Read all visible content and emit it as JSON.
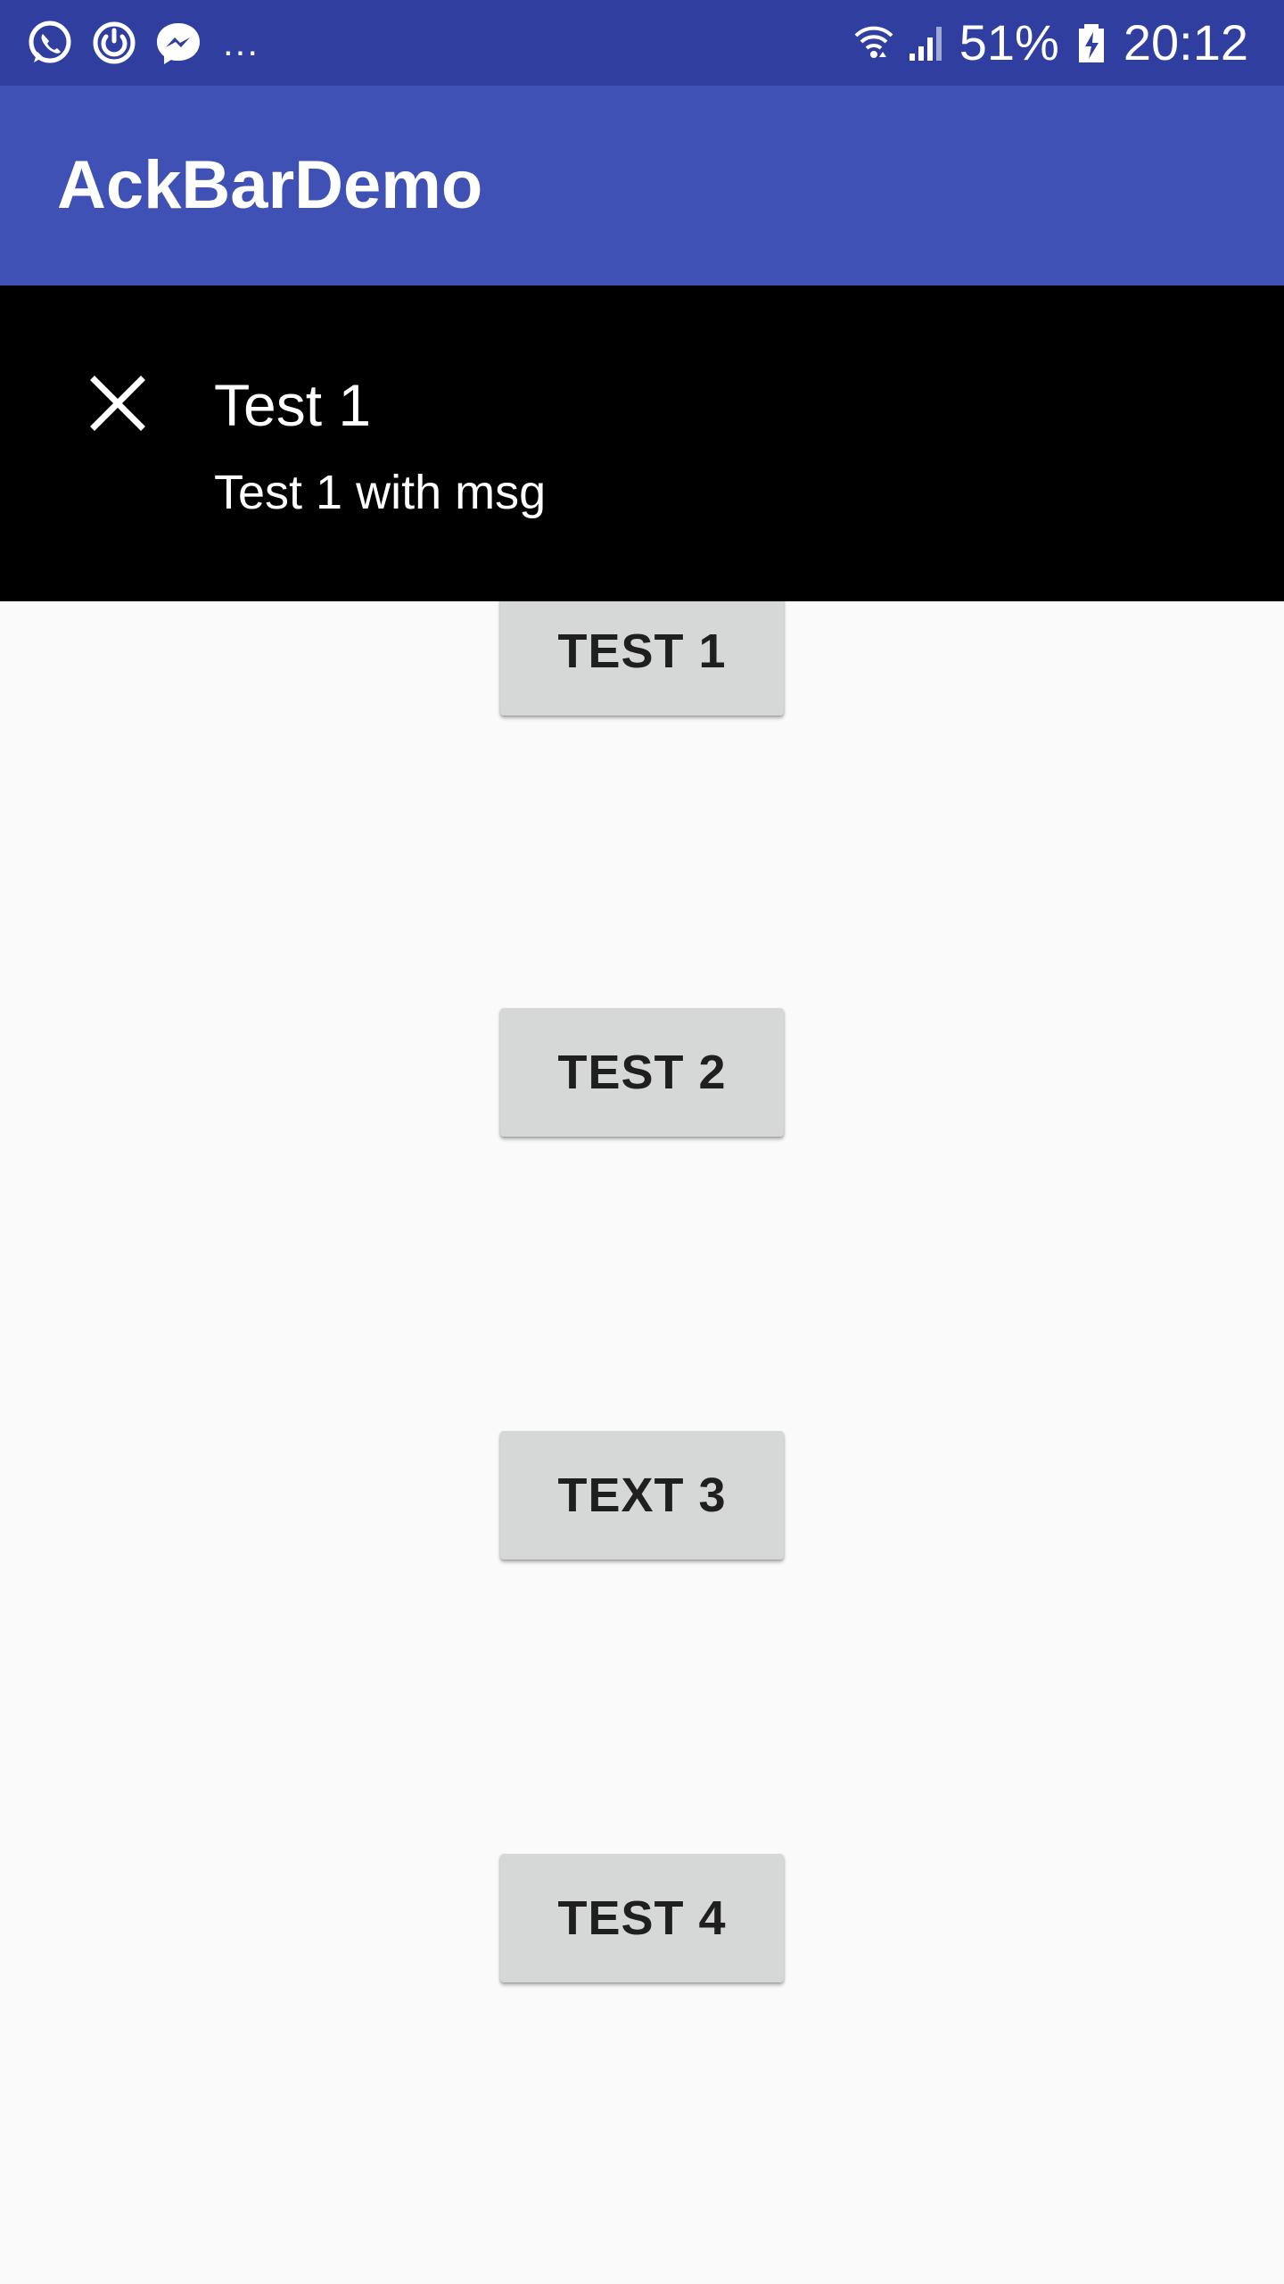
{
  "status_bar": {
    "left_icons": [
      "whatsapp-icon",
      "sync-icon",
      "messenger-icon"
    ],
    "overflow": "...",
    "battery": "51%",
    "time": "20:12",
    "right_icons": [
      "wifi-icon",
      "signal-icon",
      "battery-charging-icon"
    ]
  },
  "app_bar": {
    "title": "AckBarDemo"
  },
  "ackbar": {
    "close_icon": "close-icon",
    "title": "Test 1",
    "message": "Test 1 with msg"
  },
  "buttons": [
    {
      "label": "TEST 1"
    },
    {
      "label": "TEST 2"
    },
    {
      "label": "TEXT 3"
    },
    {
      "label": "TEST 4"
    }
  ],
  "colors": {
    "status_bar": "#303f9f",
    "app_bar": "#3f51b5",
    "ackbar": "#000000",
    "background": "#fafafa",
    "button": "#d6d7d7"
  }
}
